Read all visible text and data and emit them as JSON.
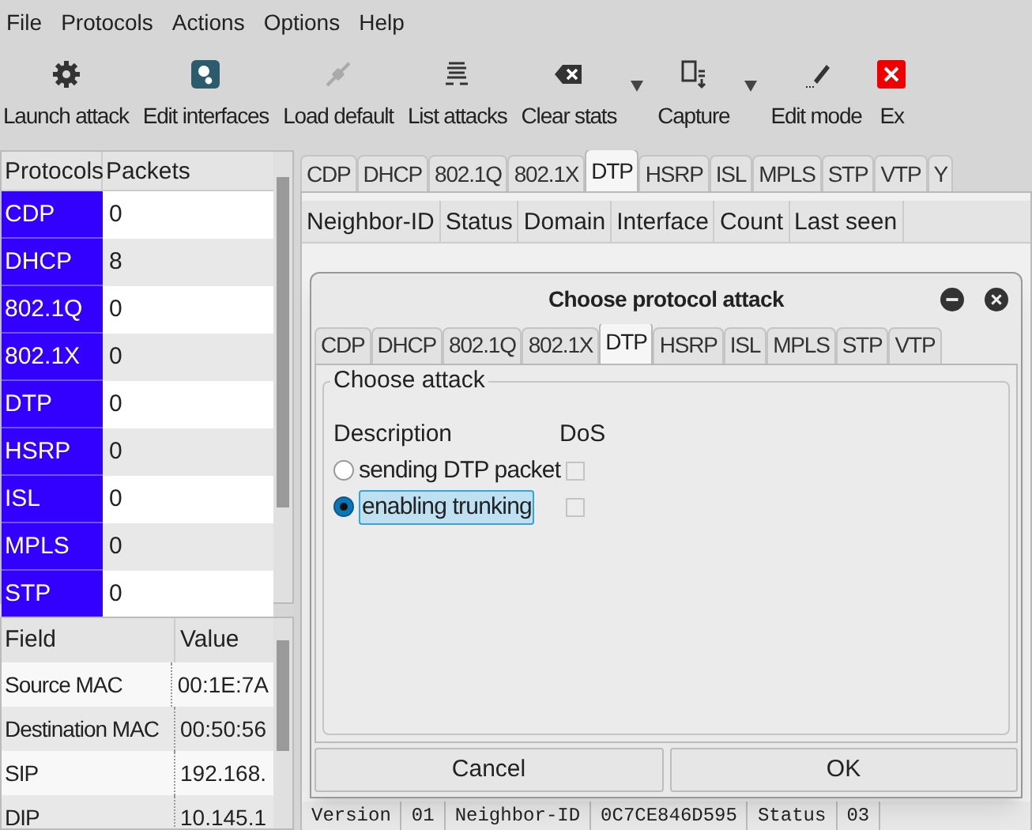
{
  "menu": [
    "File",
    "Protocols",
    "Actions",
    "Options",
    "Help"
  ],
  "toolbar": [
    {
      "label": "Launch attack",
      "dropdown": false
    },
    {
      "label": "Edit interfaces",
      "dropdown": false
    },
    {
      "label": "Load default",
      "dropdown": false
    },
    {
      "label": "List attacks",
      "dropdown": false
    },
    {
      "label": "Clear stats",
      "dropdown": true
    },
    {
      "label": "Capture",
      "dropdown": true
    },
    {
      "label": "Edit mode",
      "dropdown": false
    },
    {
      "label": "Ex",
      "dropdown": false
    }
  ],
  "protocols_table": {
    "columns": [
      "Protocols",
      "Packets"
    ],
    "rows": [
      {
        "protocol": "CDP",
        "packets": "0"
      },
      {
        "protocol": "DHCP",
        "packets": "8"
      },
      {
        "protocol": "802.1Q",
        "packets": "0"
      },
      {
        "protocol": "802.1X",
        "packets": "0"
      },
      {
        "protocol": "DTP",
        "packets": "0"
      },
      {
        "protocol": "HSRP",
        "packets": "0"
      },
      {
        "protocol": "ISL",
        "packets": "0"
      },
      {
        "protocol": "MPLS",
        "packets": "0"
      },
      {
        "protocol": "STP",
        "packets": "0"
      }
    ]
  },
  "fields_table": {
    "columns": [
      "Field",
      "Value"
    ],
    "rows": [
      {
        "field": "Source MAC",
        "value": "00:1E:7A"
      },
      {
        "field": "Destination MAC",
        "value": "00:50:56"
      },
      {
        "field": "SIP",
        "value": "192.168."
      },
      {
        "field": "DIP",
        "value": "10.145.1"
      }
    ]
  },
  "main_tabs": [
    {
      "label": "CDP",
      "selected": false
    },
    {
      "label": "DHCP",
      "selected": false
    },
    {
      "label": "802.1Q",
      "selected": false
    },
    {
      "label": "802.1X",
      "selected": false
    },
    {
      "label": "DTP",
      "selected": true
    },
    {
      "label": "HSRP",
      "selected": false
    },
    {
      "label": "ISL",
      "selected": false
    },
    {
      "label": "MPLS",
      "selected": false
    },
    {
      "label": "STP",
      "selected": false
    },
    {
      "label": "VTP",
      "selected": false
    },
    {
      "label": "Y",
      "selected": false
    }
  ],
  "main_columns": [
    "Neighbor-ID",
    "Status",
    "Domain",
    "Interface",
    "Count",
    "Last seen"
  ],
  "lower_row": [
    "Version",
    "01",
    "Neighbor-ID",
    "0C7CE846D595",
    "Status",
    "03"
  ],
  "dialog": {
    "title": "Choose protocol attack",
    "tabs": [
      {
        "label": "CDP",
        "selected": false
      },
      {
        "label": "DHCP",
        "selected": false
      },
      {
        "label": "802.1Q",
        "selected": false
      },
      {
        "label": "802.1X",
        "selected": false
      },
      {
        "label": "DTP",
        "selected": true
      },
      {
        "label": "HSRP",
        "selected": false
      },
      {
        "label": "ISL",
        "selected": false
      },
      {
        "label": "MPLS",
        "selected": false
      },
      {
        "label": "STP",
        "selected": false
      },
      {
        "label": "VTP",
        "selected": false
      }
    ],
    "group_title": "Choose attack",
    "columns": [
      "Description",
      "DoS"
    ],
    "attacks": [
      {
        "description": "sending DTP packet",
        "selected": false,
        "dos": false
      },
      {
        "description": "enabling trunking",
        "selected": true,
        "dos": false
      }
    ],
    "buttons": [
      "Cancel",
      "OK"
    ]
  }
}
